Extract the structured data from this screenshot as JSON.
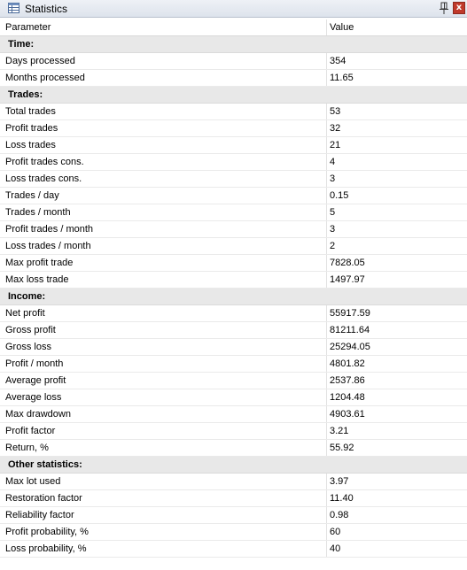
{
  "window": {
    "title": "Statistics",
    "pin_icon": "pin-icon",
    "close_icon": "close-icon",
    "close_glyph": "x",
    "table_icon": "table-icon"
  },
  "columns": {
    "parameter": "Parameter",
    "value": "Value"
  },
  "groups": [
    {
      "label": "Time:",
      "rows": [
        {
          "param": "Days processed",
          "value": "354"
        },
        {
          "param": "Months processed",
          "value": "11.65"
        }
      ]
    },
    {
      "label": "Trades:",
      "rows": [
        {
          "param": "Total trades",
          "value": "53"
        },
        {
          "param": "Profit trades",
          "value": "32"
        },
        {
          "param": "Loss trades",
          "value": "21"
        },
        {
          "param": "Profit trades cons.",
          "value": "4"
        },
        {
          "param": "Loss trades cons.",
          "value": "3"
        },
        {
          "param": "Trades / day",
          "value": "0.15"
        },
        {
          "param": "Trades / month",
          "value": "5"
        },
        {
          "param": "Profit trades / month",
          "value": "3"
        },
        {
          "param": "Loss trades / month",
          "value": "2"
        },
        {
          "param": "Max profit trade",
          "value": "7828.05"
        },
        {
          "param": "Max loss trade",
          "value": "1497.97"
        }
      ]
    },
    {
      "label": "Income:",
      "rows": [
        {
          "param": "Net profit",
          "value": "55917.59"
        },
        {
          "param": "Gross profit",
          "value": "81211.64"
        },
        {
          "param": "Gross loss",
          "value": "25294.05"
        },
        {
          "param": "Profit / month",
          "value": "4801.82"
        },
        {
          "param": "Average profit",
          "value": "2537.86"
        },
        {
          "param": "Average loss",
          "value": "1204.48"
        },
        {
          "param": "Max drawdown",
          "value": "4903.61"
        },
        {
          "param": "Profit factor",
          "value": "3.21"
        },
        {
          "param": "Return, %",
          "value": "55.92"
        }
      ]
    },
    {
      "label": "Other statistics:",
      "rows": [
        {
          "param": "Max lot used",
          "value": "3.97"
        },
        {
          "param": "Restoration factor",
          "value": "11.40"
        },
        {
          "param": "Reliability factor",
          "value": "0.98"
        },
        {
          "param": "Profit probability, %",
          "value": "60"
        },
        {
          "param": "Loss probability, %",
          "value": "40"
        }
      ]
    }
  ]
}
